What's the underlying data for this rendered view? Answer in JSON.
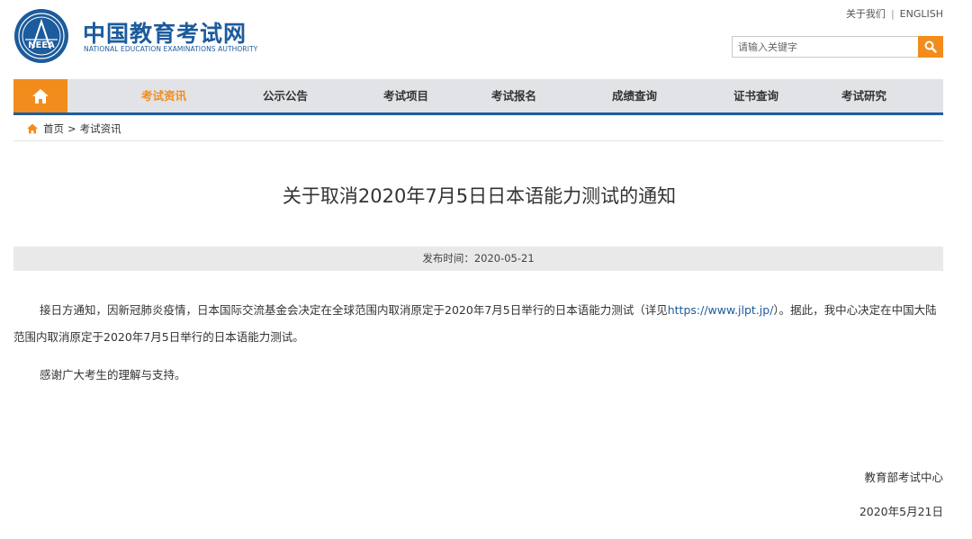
{
  "header": {
    "logo_text": "NEEA",
    "site_title": "中国教育考试网",
    "site_subtitle": "NATIONAL EDUCATION EXAMINATIONS AUTHORITY",
    "toplinks": {
      "about": "关于我们",
      "separator": "|",
      "english": "ENGLISH"
    },
    "search": {
      "placeholder": "请输入关键字",
      "icon": "search-icon"
    }
  },
  "nav": {
    "home_icon": "home-icon",
    "items": [
      {
        "label": "考试资讯",
        "active": true
      },
      {
        "label": "公示公告"
      },
      {
        "label": "考试项目"
      },
      {
        "label": "考试报名"
      },
      {
        "label": "成绩查询"
      },
      {
        "label": "证书查询"
      },
      {
        "label": "考试研究"
      }
    ]
  },
  "breadcrumb": {
    "icon": "home-icon",
    "home": "首页",
    "separator": ">",
    "current": "考试资讯"
  },
  "article": {
    "title": "关于取消2020年7月5日日本语能力测试的通知",
    "publish_label": "发布时间：",
    "publish_date": "2020-05-21",
    "paragraph1_before": "接日方通知，因新冠肺炎疫情，日本国际交流基金会决定在全球范围内取消原定于2020年7月5日举行的日本语能力测试（详见",
    "paragraph1_link": "https://www.jlpt.jp/",
    "paragraph1_after": "）。据此，我中心决定在中国大陆范围内取消原定于2020年7月5日举行的日本语能力测试。",
    "paragraph2": "感谢广大考生的理解与支持。",
    "signature_org": "教育部考试中心",
    "signature_date": "2020年5月21日"
  },
  "colors": {
    "brand_blue": "#1c5b9c",
    "accent_orange": "#f28c1c",
    "nav_bg": "#e1e3e6",
    "meta_bg": "#e9e9e9"
  }
}
